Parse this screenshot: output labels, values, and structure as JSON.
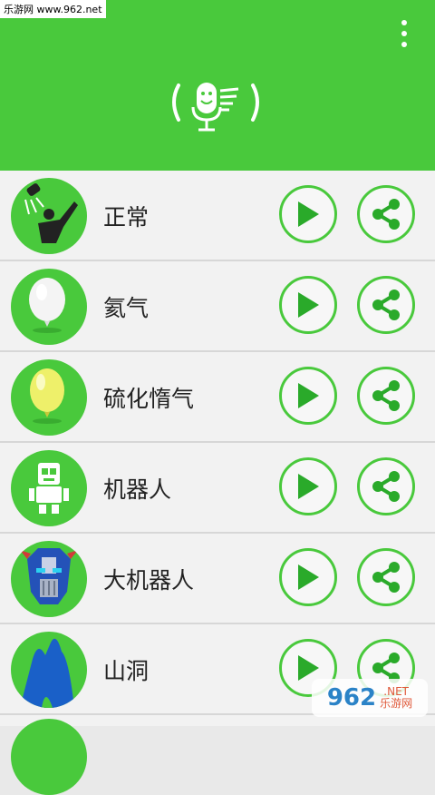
{
  "watermark": {
    "top_text": "乐游网 www.962.net",
    "bottom_num": "962",
    "bottom_net": ".NET",
    "bottom_sub": "乐游网"
  },
  "header": {
    "menu_icon": "more-vert-icon",
    "logo_icon": "microphone-icon",
    "color": "#49c93c"
  },
  "voices": [
    {
      "label": "正常",
      "icon": "shower-person-icon"
    },
    {
      "label": "氦气",
      "icon": "white-balloon-icon"
    },
    {
      "label": "硫化惰气",
      "icon": "yellow-balloon-icon"
    },
    {
      "label": "机器人",
      "icon": "robot-icon"
    },
    {
      "label": "大机器人",
      "icon": "big-robot-icon"
    },
    {
      "label": "山洞",
      "icon": "cave-icon"
    }
  ],
  "actions": {
    "play_icon": "play-icon",
    "share_icon": "share-icon"
  }
}
